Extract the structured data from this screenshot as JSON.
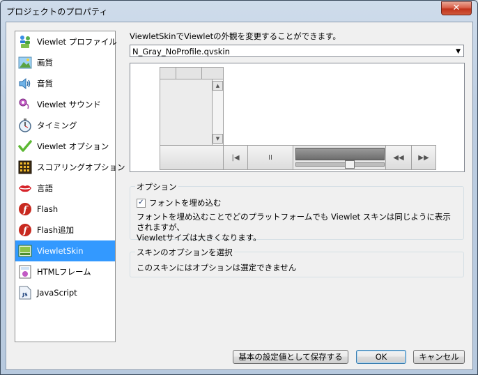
{
  "window": {
    "title": "プロジェクトのプロパティ",
    "close_symbol": "✕"
  },
  "sidebar": {
    "items": [
      {
        "label": "Viewlet プロファイル",
        "icon": "profile-icon"
      },
      {
        "label": "画質",
        "icon": "image-quality-icon"
      },
      {
        "label": "音質",
        "icon": "speaker-icon"
      },
      {
        "label": "Viewlet サウンド",
        "icon": "sound-icon"
      },
      {
        "label": "タイミング",
        "icon": "stopwatch-icon"
      },
      {
        "label": "Viewlet オプション",
        "icon": "checkmark-icon"
      },
      {
        "label": "スコアリングオプション",
        "icon": "scoreboard-icon"
      },
      {
        "label": "言語",
        "icon": "lips-icon"
      },
      {
        "label": "Flash",
        "icon": "flash-icon"
      },
      {
        "label": "Flash追加",
        "icon": "flash-add-icon"
      },
      {
        "label": "ViewletSkin",
        "icon": "skin-icon",
        "selected": true
      },
      {
        "label": "HTMLフレーム",
        "icon": "html-frame-icon"
      },
      {
        "label": "JavaScript",
        "icon": "javascript-icon"
      }
    ]
  },
  "main": {
    "description": "ViewletSkinでViewletの外観を変更することができます。",
    "skin_select": {
      "value": "N_Gray_NoProfile.qvskin",
      "arrow": "▼"
    },
    "preview": {
      "controls": {
        "rewind": "◀◀",
        "play_pause": "II",
        "first": "|◀",
        "forward": "▶▶",
        "scroll_up": "▲",
        "scroll_down": "▼"
      }
    },
    "options_group": {
      "legend": "オプション",
      "embed_fonts_label": "フォントを埋め込む",
      "embed_fonts_checked_mark": "✓",
      "note_line1": "フォントを埋め込むことでどのプラットフォームでも Viewlet スキンは同じように表示されますが、",
      "note_line2": "Viewletサイズは大きくなります。"
    },
    "skin_options_group": {
      "legend": "スキンのオプションを選択",
      "text": "このスキンにはオプションは選定できません"
    }
  },
  "footer": {
    "save_default_label": "基本の設定値として保存する",
    "ok_label": "OK",
    "cancel_label": "キャンセル"
  }
}
